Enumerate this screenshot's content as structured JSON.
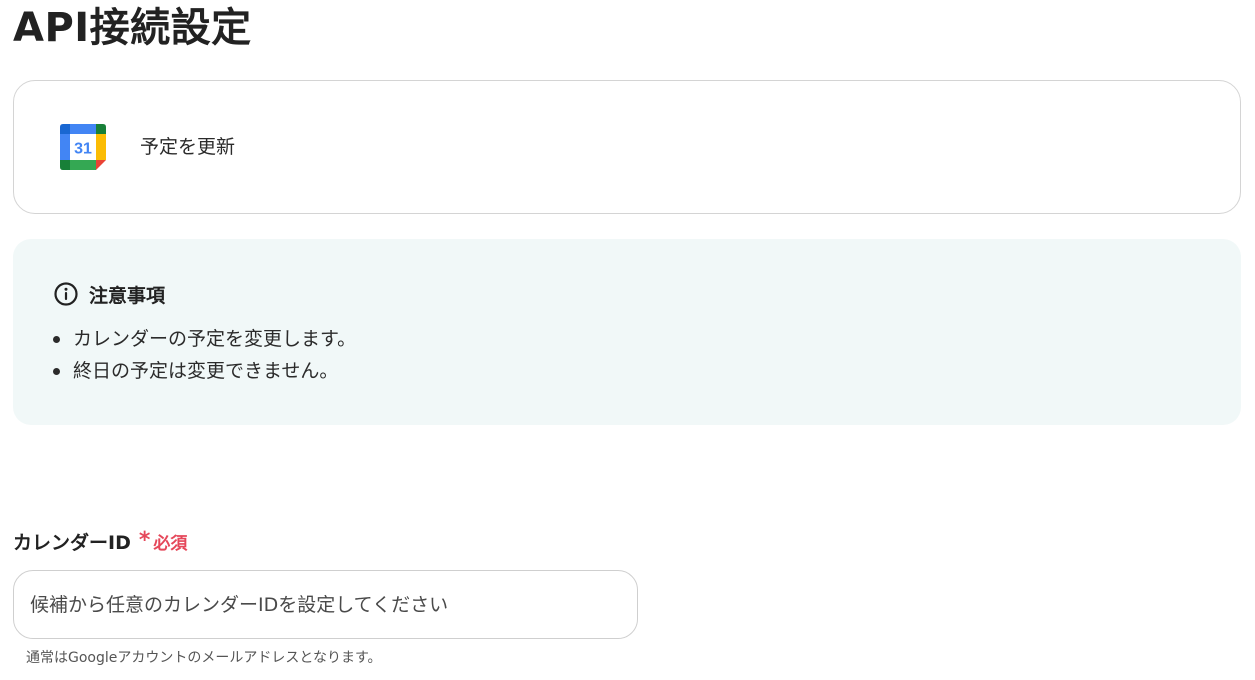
{
  "page": {
    "title": "API接続設定"
  },
  "action": {
    "icon": "google-calendar-icon",
    "icon_day": "31",
    "label": "予定を更新"
  },
  "notice": {
    "icon": "info-icon",
    "title": "注意事項",
    "items": [
      "カレンダーの予定を変更します。",
      "終日の予定は変更できません。"
    ]
  },
  "form": {
    "calendar_id": {
      "label": "カレンダーID",
      "required_mark": "*",
      "required_text": "必須",
      "value": "",
      "placeholder": "候補から任意のカレンダーIDを設定してください",
      "help": "通常はGoogleアカウントのメールアドレスとなります。"
    }
  },
  "colors": {
    "required": "#e5475a",
    "notice_background": "#f1f8f8",
    "border": "#d4d4d4",
    "gcal_blue": "#4285f4",
    "gcal_green": "#34a853",
    "gcal_yellow": "#fbbc04",
    "gcal_red": "#ea4335"
  }
}
